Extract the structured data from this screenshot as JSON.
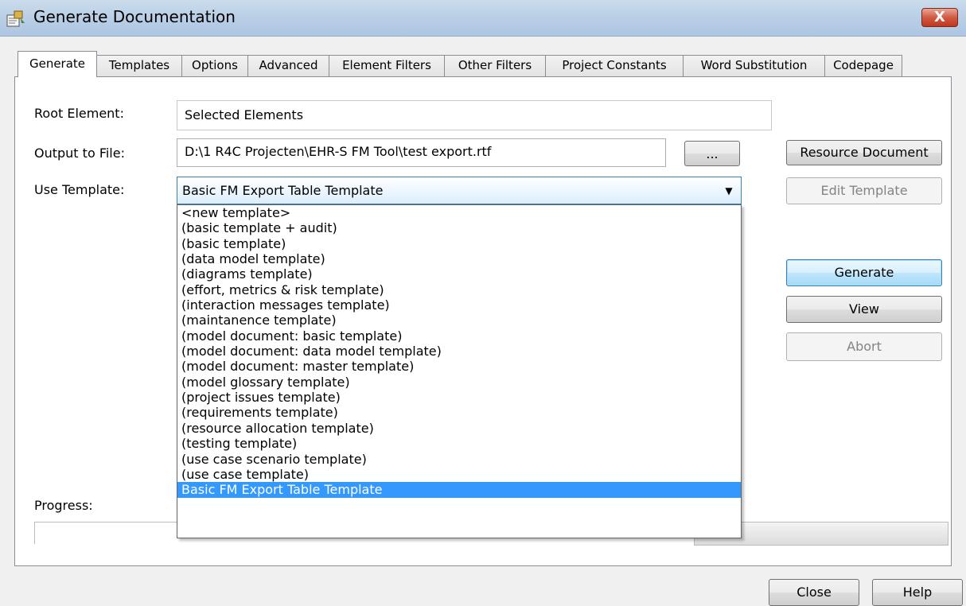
{
  "window": {
    "title": "Generate Documentation",
    "close_glyph": "X",
    "icon": "documentation-app-icon"
  },
  "tabs": [
    {
      "label": "Generate",
      "active": true
    },
    {
      "label": "Templates",
      "active": false
    },
    {
      "label": "Options",
      "active": false
    },
    {
      "label": "Advanced",
      "active": false
    },
    {
      "label": "Element Filters",
      "active": false
    },
    {
      "label": "Other Filters",
      "active": false
    },
    {
      "label": "Project Constants",
      "active": false
    },
    {
      "label": "Word Substitution",
      "active": false
    },
    {
      "label": "Codepage",
      "active": false
    }
  ],
  "form": {
    "root_element_label": "Root Element:",
    "root_element_value": "Selected Elements",
    "output_label": "Output to File:",
    "output_value": "D:\\1 R4C Projecten\\EHR-S FM Tool\\test export.rtf",
    "browse_label": "...",
    "template_label": "Use Template:",
    "template_value": "Basic FM Export Table Template",
    "progress_label": "Progress:"
  },
  "buttons": {
    "resource_document": "Resource Document",
    "edit_template": "Edit Template",
    "generate": "Generate",
    "view": "View",
    "abort": "Abort",
    "close": "Close",
    "help": "Help"
  },
  "dropdown": {
    "items": [
      "<new template>",
      "(basic template + audit)",
      "(basic template)",
      "(data model template)",
      "(diagrams template)",
      "(effort, metrics & risk template)",
      "(interaction messages template)",
      "(maintanence template)",
      "(model document: basic template)",
      "(model document: data model template)",
      "(model document: master template)",
      "(model glossary template)",
      "(project issues template)",
      "(requirements template)",
      "(resource allocation template)",
      "(testing template)",
      "(use case scenario template)",
      "(use case template)",
      "Basic FM Export Table Template"
    ],
    "selected_index": 18
  },
  "colors": {
    "selection": "#3399ff",
    "close_button": "#c1371d",
    "titlebar": "#b9cfe6"
  }
}
